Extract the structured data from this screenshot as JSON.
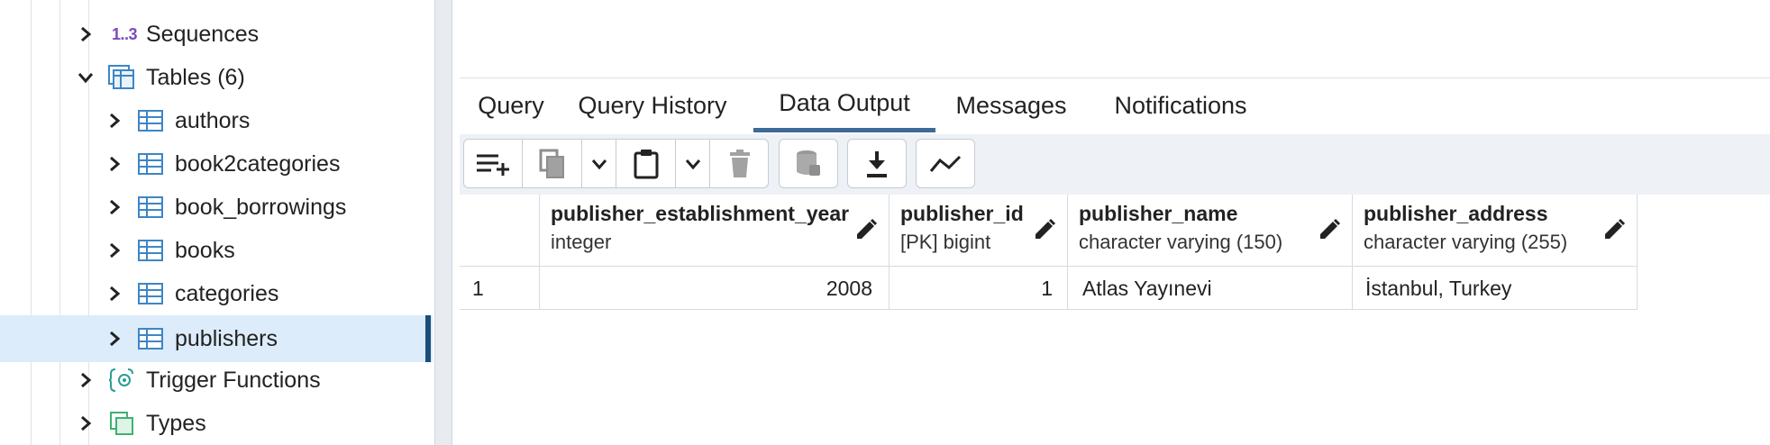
{
  "sidebar": {
    "items": [
      {
        "label": "Sequences",
        "icon": "sequence-icon",
        "icon_text": "1..3",
        "expanded": false
      },
      {
        "label": "Tables (6)",
        "icon": "tables-icon",
        "expanded": true
      },
      {
        "label": "authors",
        "icon": "table-icon",
        "expanded": false
      },
      {
        "label": "book2categories",
        "icon": "table-icon",
        "expanded": false
      },
      {
        "label": "book_borrowings",
        "icon": "table-icon",
        "expanded": false
      },
      {
        "label": "books",
        "icon": "table-icon",
        "expanded": false
      },
      {
        "label": "categories",
        "icon": "table-icon",
        "expanded": false
      },
      {
        "label": "publishers",
        "icon": "table-icon",
        "expanded": false,
        "selected": true
      },
      {
        "label": "Trigger Functions",
        "icon": "trigger-function-icon",
        "expanded": false
      },
      {
        "label": "Types",
        "icon": "types-icon",
        "expanded": false
      }
    ]
  },
  "tabs": [
    {
      "label": "Query"
    },
    {
      "label": "Query History"
    },
    {
      "label": "Data Output",
      "active": true
    },
    {
      "label": "Messages"
    },
    {
      "label": "Notifications"
    }
  ],
  "toolbar": {
    "buttons": [
      "add-row-icon",
      "copy-icon",
      "copy-dropdown-icon",
      "paste-icon",
      "paste-dropdown-icon",
      "delete-icon",
      "save-data-icon",
      "download-icon",
      "graph-icon"
    ]
  },
  "grid": {
    "columns": [
      {
        "name": "publisher_establishment_year",
        "type": "integer",
        "align": "right"
      },
      {
        "name": "publisher_id",
        "type": "[PK] bigint",
        "align": "right"
      },
      {
        "name": "publisher_name",
        "type": "character varying (150)",
        "align": "left"
      },
      {
        "name": "publisher_address",
        "type": "character varying (255)",
        "align": "left"
      }
    ],
    "rows": [
      {
        "row_number": "1",
        "values": [
          "2008",
          "1",
          "Atlas Yayınevi",
          "İstanbul, Turkey"
        ]
      }
    ]
  },
  "colors": {
    "accent": "#3d6a98",
    "selected_row": "#dcecfa",
    "selected_marker": "#1b4f7a",
    "toolbar_bg": "#eef1f5",
    "table_icon": "#3d86c6",
    "sequence_icon": "#7b4bb8",
    "trigger_icon": "#2a9d8f",
    "types_icon": "#3cb371"
  }
}
